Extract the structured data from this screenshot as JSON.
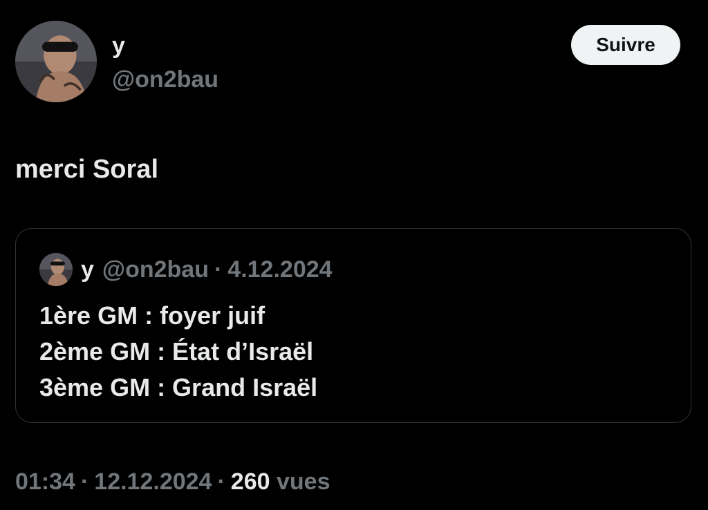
{
  "author": {
    "display_name": "y",
    "handle": "@on2bau"
  },
  "follow_button": {
    "label": "Suivre"
  },
  "tweet": {
    "text": "merci Soral"
  },
  "quoted_tweet": {
    "display_name": "y",
    "handle": "@on2bau",
    "separator": "·",
    "date": "4.12.2024",
    "lines": [
      "1ère GM : foyer juif",
      "2ème GM : État d’Israël",
      "3ème GM : Grand Israël"
    ]
  },
  "footer": {
    "time": "01:34",
    "separator": "·",
    "date": "12.12.2024",
    "view_count": "260",
    "views_label": "vues"
  },
  "colors": {
    "background": "#000000",
    "primary_text": "#e7e9ea",
    "secondary_text": "#71767b",
    "button_bg": "#eff3f4",
    "card_border": "#2f3336"
  }
}
